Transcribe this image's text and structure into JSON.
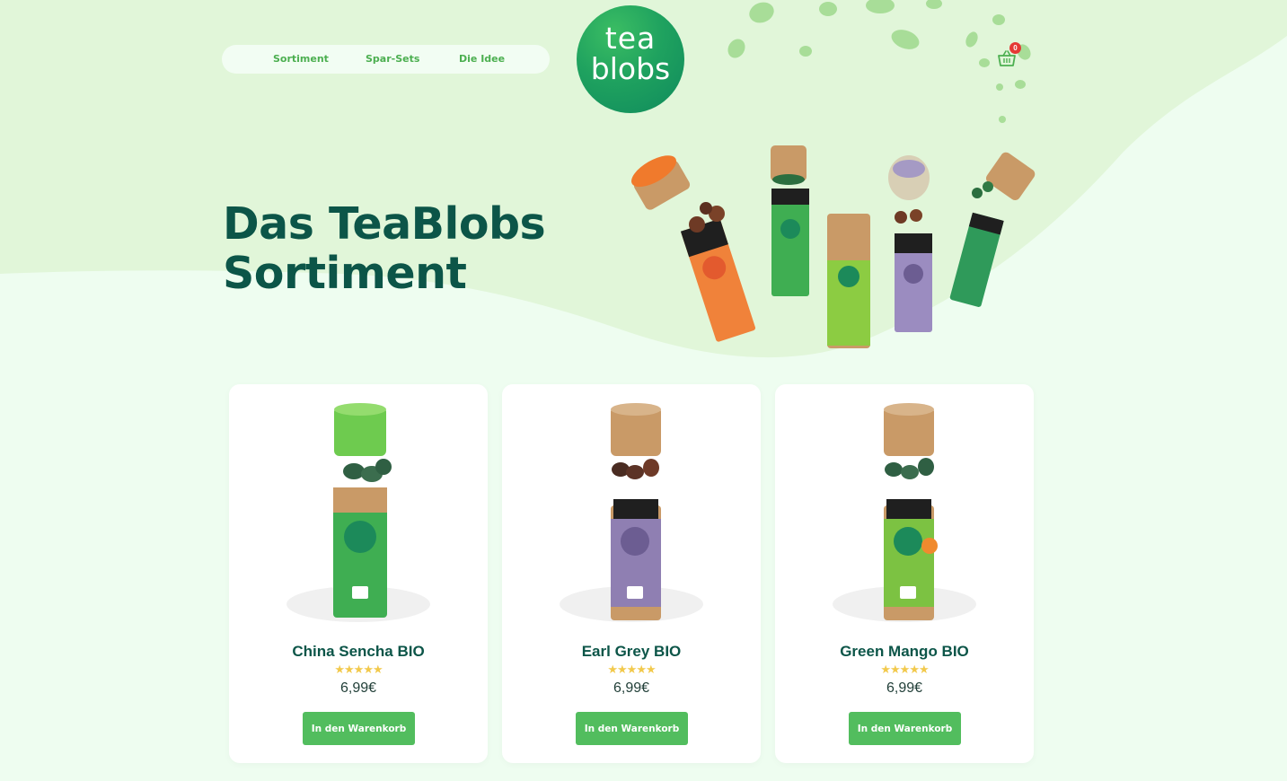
{
  "colors": {
    "brand_green": "#1fa25f",
    "heading_green": "#0c5548",
    "button_green": "#52bd5e",
    "nav_text": "#4caf50",
    "badge_red": "#e53935",
    "page_bg": "#eefdf0",
    "hero_bg": "#e1f6d9"
  },
  "nav": {
    "items": [
      {
        "label": "Sortiment"
      },
      {
        "label": "Spar-Sets"
      },
      {
        "label": "Die Idee"
      }
    ]
  },
  "logo": {
    "line1": "tea",
    "line2": "blobs"
  },
  "cart": {
    "icon": "basket-icon",
    "count": "0"
  },
  "hero": {
    "title_line1": "Das TeaBlobs",
    "title_line2": "Sortiment"
  },
  "products": [
    {
      "name": "China Sencha BIO",
      "stars": "★★★★★",
      "rating": 5,
      "price": "6,99€",
      "button": "In den Warenkorb",
      "color": "#3fae52"
    },
    {
      "name": "Earl Grey BIO",
      "stars": "★★★★★",
      "rating": 5,
      "price": "6,99€",
      "button": "In den Warenkorb",
      "color": "#8f7fb2"
    },
    {
      "name": "Green Mango BIO",
      "stars": "★★★★★",
      "rating": 5,
      "price": "6,99€",
      "button": "In den Warenkorb",
      "color": "#7cc242"
    }
  ]
}
